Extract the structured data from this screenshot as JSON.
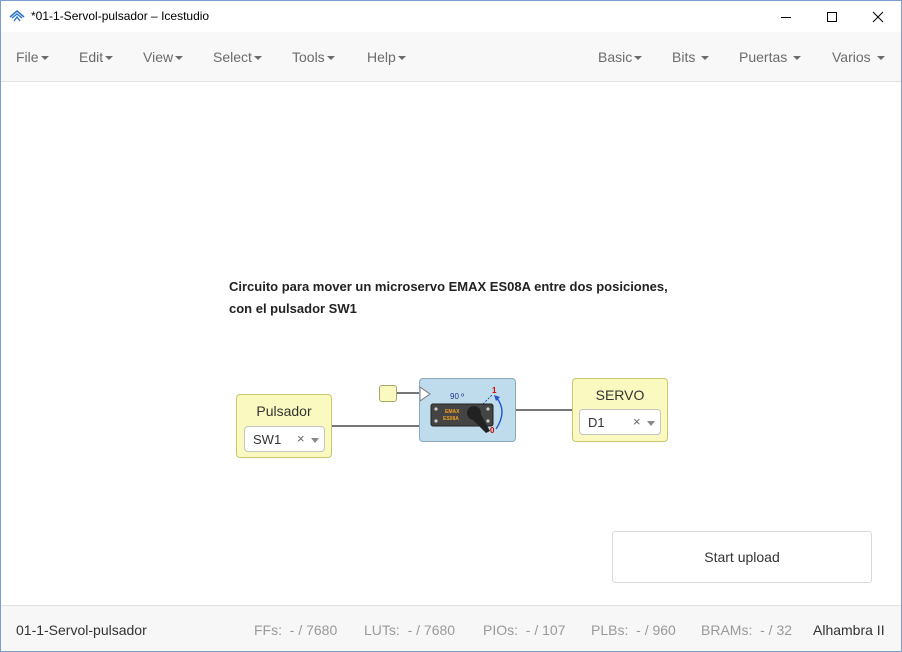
{
  "window": {
    "title": "*01-1-Servol-pulsador – Icestudio"
  },
  "menu": {
    "left": [
      {
        "label": "File"
      },
      {
        "label": "Edit"
      },
      {
        "label": "View"
      },
      {
        "label": "Select"
      },
      {
        "label": "Tools"
      },
      {
        "label": "Help"
      }
    ],
    "right": [
      {
        "label": "Basic"
      },
      {
        "label": "Bits"
      },
      {
        "label": "Puertas"
      },
      {
        "label": "Varios"
      }
    ]
  },
  "canvas": {
    "info_line1": "Circuito para mover un microservo EMAX ES08A entre dos posiciones,",
    "info_line2": "con el pulsador SW1",
    "input_block": {
      "name": "Pulsador",
      "selected": "SW1",
      "clear": "×"
    },
    "servo_block": {
      "angle_label": "90 º",
      "pos1_label": "1",
      "pos0_label": "0",
      "brand_line1": "EMAX",
      "brand_line2": "ES08A"
    },
    "output_block": {
      "name": "SERVO",
      "selected": "D1",
      "clear": "×"
    },
    "upload_label": "Start upload"
  },
  "status": {
    "project_name": "01-1-Servol-pulsador",
    "ffs_label": "FFs:",
    "ffs_value": "- / 7680",
    "luts_label": "LUTs:",
    "luts_value": "- / 7680",
    "pios_label": "PIOs:",
    "pios_value": "- / 107",
    "plbs_label": "PLBs:",
    "plbs_value": "- / 960",
    "brams_label": "BRAMs:",
    "brams_value": "- / 32",
    "board": "Alhambra II"
  },
  "icons": {
    "app": "icestudio-logo-icon",
    "minimize": "minimize-icon",
    "maximize": "maximize-icon",
    "close": "close-icon"
  },
  "colors": {
    "block_fill": "#fafac0",
    "servo_fill": "#bfdcec",
    "menu_bg": "#f8f8f8"
  }
}
